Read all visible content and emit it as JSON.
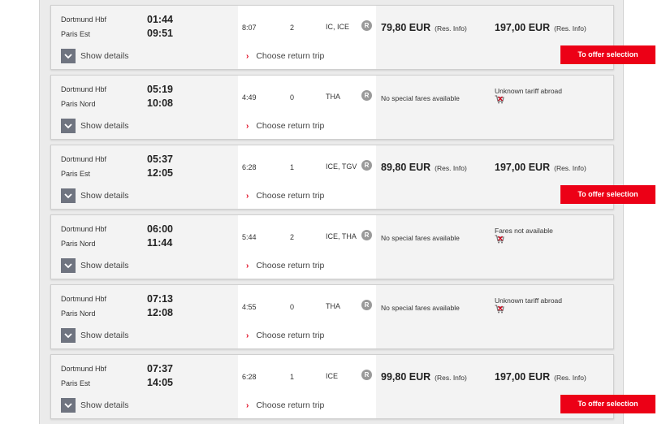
{
  "labels": {
    "show_details": "Show details",
    "choose_return": "Choose return trip",
    "res_info": "(Res. Info)",
    "offer_button": "To offer selection",
    "r_badge": "R"
  },
  "colors": {
    "accent": "#ec0016",
    "details_box": "#6f7480"
  },
  "icons": {
    "details": "chevron-down-icon",
    "return": "chevron-right-icon",
    "reservation": "reservation-icon",
    "unavailable": "cart-unavailable-icon"
  },
  "connections": [
    {
      "from": "Dortmund Hbf",
      "to": "Paris Est",
      "dep": "01:44",
      "arr": "09:51",
      "duration": "8:07",
      "changes": "2",
      "products": "IC, ICE",
      "fare1": "79,80 EUR",
      "fare1_res": true,
      "fare1_text": "",
      "fare2": "197,00 EUR",
      "fare2_res": true,
      "fare2_text": "",
      "offer": true
    },
    {
      "from": "Dortmund Hbf",
      "to": "Paris Nord",
      "dep": "05:19",
      "arr": "10:08",
      "duration": "4:49",
      "changes": "0",
      "products": "THA",
      "fare1": "",
      "fare1_res": false,
      "fare1_text": "No special fares available",
      "fare2": "",
      "fare2_res": false,
      "fare2_text": "Unknown tariff abroad",
      "offer": false
    },
    {
      "from": "Dortmund Hbf",
      "to": "Paris Est",
      "dep": "05:37",
      "arr": "12:05",
      "duration": "6:28",
      "changes": "1",
      "products": "ICE, TGV",
      "fare1": "89,80 EUR",
      "fare1_res": true,
      "fare1_text": "",
      "fare2": "197,00 EUR",
      "fare2_res": true,
      "fare2_text": "",
      "offer": true
    },
    {
      "from": "Dortmund Hbf",
      "to": "Paris Nord",
      "dep": "06:00",
      "arr": "11:44",
      "duration": "5:44",
      "changes": "2",
      "products": "ICE, THA",
      "fare1": "",
      "fare1_res": false,
      "fare1_text": "No special fares available",
      "fare2": "",
      "fare2_res": false,
      "fare2_text": "Fares not available",
      "offer": false
    },
    {
      "from": "Dortmund Hbf",
      "to": "Paris Nord",
      "dep": "07:13",
      "arr": "12:08",
      "duration": "4:55",
      "changes": "0",
      "products": "THA",
      "fare1": "",
      "fare1_res": false,
      "fare1_text": "No special fares available",
      "fare2": "",
      "fare2_res": false,
      "fare2_text": "Unknown tariff abroad",
      "offer": false
    },
    {
      "from": "Dortmund Hbf",
      "to": "Paris Est",
      "dep": "07:37",
      "arr": "14:05",
      "duration": "6:28",
      "changes": "1",
      "products": "ICE",
      "fare1": "99,80 EUR",
      "fare1_res": true,
      "fare1_text": "",
      "fare2": "197,00 EUR",
      "fare2_res": true,
      "fare2_text": "",
      "offer": true
    }
  ]
}
